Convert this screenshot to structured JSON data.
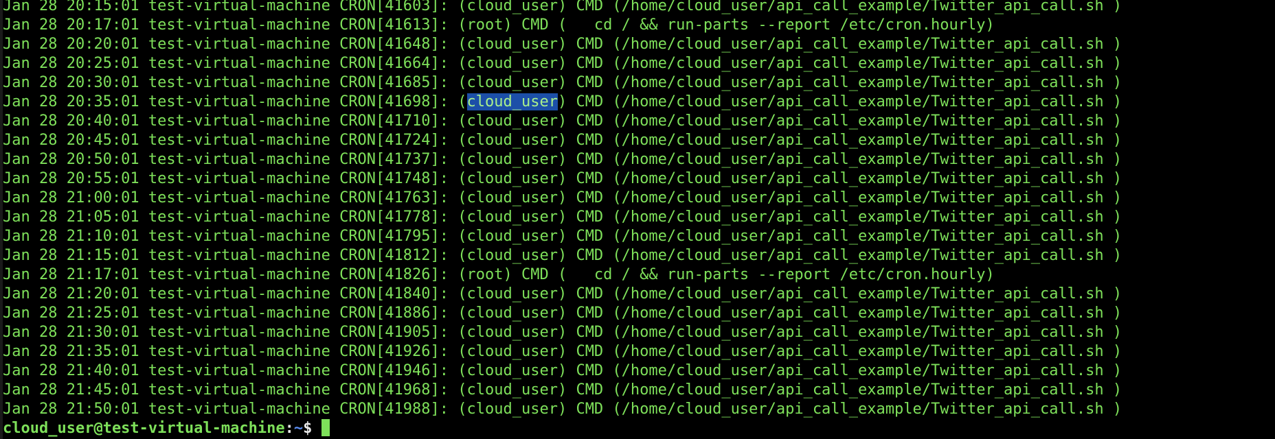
{
  "terminal": {
    "colors": {
      "background": "#000000",
      "text": "#7ee05a",
      "selection": "#1c4fa8",
      "path": "#5a8cf0"
    },
    "lines": [
      {
        "pre": "Jan 28 20:15:01 test-virtual-machine CRON[41603]: (cloud_user) CMD (/home/cloud_user/api_call_example/Twitter_api_call.sh )"
      },
      {
        "pre": "Jan 28 20:17:01 test-virtual-machine CRON[41613]: (root) CMD (   cd / && run-parts --report /etc/cron.hourly)"
      },
      {
        "pre": "Jan 28 20:20:01 test-virtual-machine CRON[41648]: (cloud_user) CMD (/home/cloud_user/api_call_example/Twitter_api_call.sh )"
      },
      {
        "pre": "Jan 28 20:25:01 test-virtual-machine CRON[41664]: (cloud_user) CMD (/home/cloud_user/api_call_example/Twitter_api_call.sh )"
      },
      {
        "pre": "Jan 28 20:30:01 test-virtual-machine CRON[41685]: (cloud_user) CMD (/home/cloud_user/api_call_example/Twitter_api_call.sh )"
      },
      {
        "pre": "Jan 28 20:35:01 test-virtual-machine CRON[41698]: (",
        "sel": "cloud_user",
        "post": ") CMD (/home/cloud_user/api_call_example/Twitter_api_call.sh )"
      },
      {
        "pre": "Jan 28 20:40:01 test-virtual-machine CRON[41710]: (cloud_user) CMD (/home/cloud_user/api_call_example/Twitter_api_call.sh )"
      },
      {
        "pre": "Jan 28 20:45:01 test-virtual-machine CRON[41724]: (cloud_user) CMD (/home/cloud_user/api_call_example/Twitter_api_call.sh )"
      },
      {
        "pre": "Jan 28 20:50:01 test-virtual-machine CRON[41737]: (cloud_user) CMD (/home/cloud_user/api_call_example/Twitter_api_call.sh )"
      },
      {
        "pre": "Jan 28 20:55:01 test-virtual-machine CRON[41748]: (cloud_user) CMD (/home/cloud_user/api_call_example/Twitter_api_call.sh )"
      },
      {
        "pre": "Jan 28 21:00:01 test-virtual-machine CRON[41763]: (cloud_user) CMD (/home/cloud_user/api_call_example/Twitter_api_call.sh )"
      },
      {
        "pre": "Jan 28 21:05:01 test-virtual-machine CRON[41778]: (cloud_user) CMD (/home/cloud_user/api_call_example/Twitter_api_call.sh )"
      },
      {
        "pre": "Jan 28 21:10:01 test-virtual-machine CRON[41795]: (cloud_user) CMD (/home/cloud_user/api_call_example/Twitter_api_call.sh )"
      },
      {
        "pre": "Jan 28 21:15:01 test-virtual-machine CRON[41812]: (cloud_user) CMD (/home/cloud_user/api_call_example/Twitter_api_call.sh )"
      },
      {
        "pre": "Jan 28 21:17:01 test-virtual-machine CRON[41826]: (root) CMD (   cd / && run-parts --report /etc/cron.hourly)"
      },
      {
        "pre": "Jan 28 21:20:01 test-virtual-machine CRON[41840]: (cloud_user) CMD (/home/cloud_user/api_call_example/Twitter_api_call.sh )"
      },
      {
        "pre": "Jan 28 21:25:01 test-virtual-machine CRON[41886]: (cloud_user) CMD (/home/cloud_user/api_call_example/Twitter_api_call.sh )"
      },
      {
        "pre": "Jan 28 21:30:01 test-virtual-machine CRON[41905]: (cloud_user) CMD (/home/cloud_user/api_call_example/Twitter_api_call.sh )"
      },
      {
        "pre": "Jan 28 21:35:01 test-virtual-machine CRON[41926]: (cloud_user) CMD (/home/cloud_user/api_call_example/Twitter_api_call.sh )"
      },
      {
        "pre": "Jan 28 21:40:01 test-virtual-machine CRON[41946]: (cloud_user) CMD (/home/cloud_user/api_call_example/Twitter_api_call.sh )"
      },
      {
        "pre": "Jan 28 21:45:01 test-virtual-machine CRON[41968]: (cloud_user) CMD (/home/cloud_user/api_call_example/Twitter_api_call.sh )"
      },
      {
        "pre": "Jan 28 21:50:01 test-virtual-machine CRON[41988]: (cloud_user) CMD (/home/cloud_user/api_call_example/Twitter_api_call.sh )"
      }
    ],
    "prompt": {
      "user_host": "cloud_user@test-virtual-machine",
      "colon": ":",
      "path": "~",
      "symbol": "$ "
    }
  }
}
